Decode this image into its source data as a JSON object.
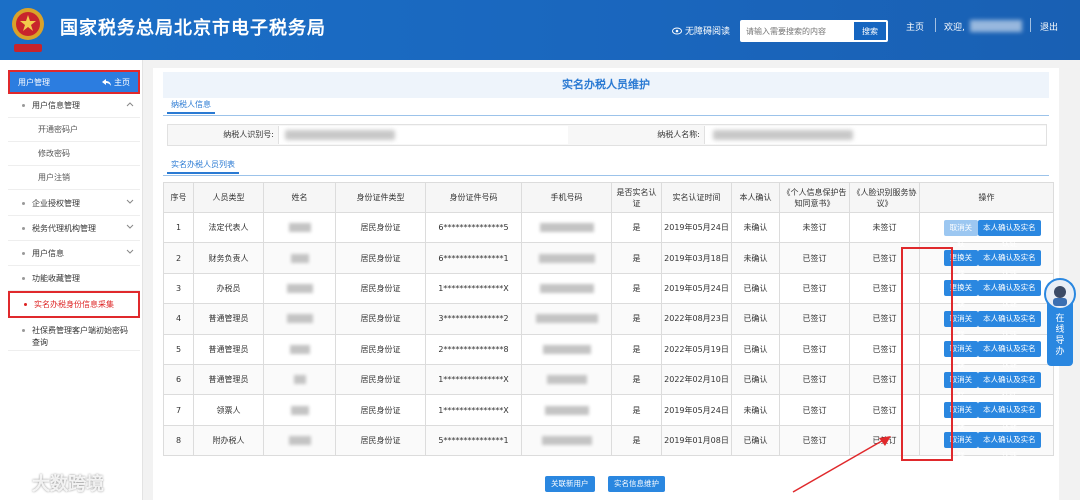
{
  "header": {
    "title": "国家税务总局北京市电子税务局",
    "accessible_label": "无障碍阅读",
    "search_placeholder": "请输入需要搜索的内容",
    "search_button": "搜索",
    "home_label": "主页",
    "welcome_label": "欢迎,",
    "logout_label": "退出",
    "accent": "#1b6fc7"
  },
  "sidebar": {
    "head_label": "用户管理",
    "head_home": "主页",
    "items": [
      {
        "label": "用户信息管理",
        "type": "group",
        "expanded": true
      },
      {
        "label": "开通密码户",
        "type": "sub"
      },
      {
        "label": "修改密码",
        "type": "sub"
      },
      {
        "label": "用户注销",
        "type": "sub"
      },
      {
        "label": "企业授权管理",
        "type": "group"
      },
      {
        "label": "税务代理机构管理",
        "type": "group"
      },
      {
        "label": "用户信息",
        "type": "group"
      },
      {
        "label": "功能收藏管理",
        "type": "item"
      },
      {
        "label": "实名办税身份信息采集",
        "type": "item",
        "active": true
      },
      {
        "label": "社保费管理客户端初始密码查询",
        "type": "item"
      }
    ]
  },
  "main": {
    "page_title": "实名办税人员维护",
    "taxpayer_tab": "纳税人信息",
    "taxpayer_id_label": "纳税人识别号:",
    "taxpayer_name_label": "纳税人名称:",
    "list_tab": "实名办税人员列表",
    "columns": [
      "序号",
      "人员类型",
      "姓名",
      "身份证件类型",
      "身份证件号码",
      "手机号码",
      "是否实名认证",
      "实名认证时间",
      "本人确认",
      "《个人信息保护告知同意书》",
      "《人脸识别服务协议》",
      "操作"
    ],
    "rows": [
      {
        "no": "1",
        "type": "法定代表人",
        "id_type": "居民身份证",
        "id_no": "6***************5",
        "verified": "是",
        "time": "2019年05月24日",
        "confirm": "未确认",
        "privacy": "未签订",
        "face": "未签订",
        "op1": "取消关联",
        "op1_light": true,
        "op2": "本人确认及实名认证"
      },
      {
        "no": "2",
        "type": "财务负责人",
        "id_type": "居民身份证",
        "id_no": "6***************1",
        "verified": "是",
        "time": "2019年03月18日",
        "confirm": "未确认",
        "privacy": "已签订",
        "face": "已签订",
        "op1": "更换关联",
        "op1_light": false,
        "op2": "本人确认及实名认证"
      },
      {
        "no": "3",
        "type": "办税员",
        "id_type": "居民身份证",
        "id_no": "1***************X",
        "verified": "是",
        "time": "2019年05月24日",
        "confirm": "已确认",
        "privacy": "已签订",
        "face": "已签订",
        "op1": "更换关联",
        "op1_light": false,
        "op2": "本人确认及实名认证"
      },
      {
        "no": "4",
        "type": "普通管理员",
        "id_type": "居民身份证",
        "id_no": "3***************2",
        "verified": "是",
        "time": "2022年08月23日",
        "confirm": "已确认",
        "privacy": "已签订",
        "face": "已签订",
        "op1": "取消关联",
        "op1_light": false,
        "op2": "本人确认及实名认证"
      },
      {
        "no": "5",
        "type": "普通管理员",
        "id_type": "居民身份证",
        "id_no": "2***************8",
        "verified": "是",
        "time": "2022年05月19日",
        "confirm": "已确认",
        "privacy": "已签订",
        "face": "已签订",
        "op1": "取消关联",
        "op1_light": false,
        "op2": "本人确认及实名认证"
      },
      {
        "no": "6",
        "type": "普通管理员",
        "id_type": "居民身份证",
        "id_no": "1***************X",
        "verified": "是",
        "time": "2022年02月10日",
        "confirm": "已确认",
        "privacy": "已签订",
        "face": "已签订",
        "op1": "取消关联",
        "op1_light": false,
        "op2": "本人确认及实名认证"
      },
      {
        "no": "7",
        "type": "领票人",
        "id_type": "居民身份证",
        "id_no": "1***************X",
        "verified": "是",
        "time": "2019年05月24日",
        "confirm": "未确认",
        "privacy": "已签订",
        "face": "已签订",
        "op1": "取消关联",
        "op1_light": false,
        "op2": "本人确认及实名认证"
      },
      {
        "no": "8",
        "type": "附办税人",
        "id_type": "居民身份证",
        "id_no": "5***************1",
        "verified": "是",
        "time": "2019年01月08日",
        "confirm": "已确认",
        "privacy": "已签订",
        "face": "已签订",
        "op1": "取消关联",
        "op1_light": false,
        "op2": "本人确认及实名认证"
      }
    ],
    "btn_add_user": "关联新用户",
    "btn_maintain": "实名信息维护"
  },
  "float_guide": "在线导办",
  "watermark": "大数跨境"
}
